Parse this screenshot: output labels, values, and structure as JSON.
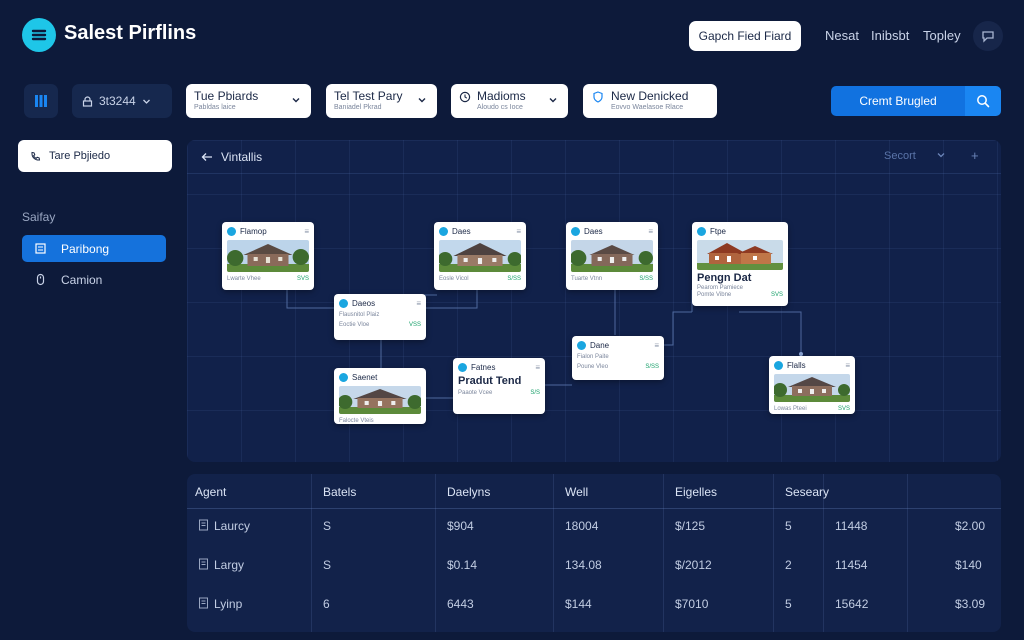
{
  "app": {
    "title": "Salest Pirflins"
  },
  "topbar": {
    "action_button": "Gapch Fied Fiard",
    "links": [
      "Nesat",
      "Inibsbt",
      "Topley"
    ]
  },
  "filterbar": {
    "id_select": "3t3244",
    "filters": [
      {
        "label": "Tue Pbiards",
        "sub": "Pabldas laice"
      },
      {
        "label": "Tel Test Pary",
        "sub": "Baniadel Pkrad"
      },
      {
        "label": "Madioms",
        "sub": "Aloudo cs Ioce"
      },
      {
        "label": "New Denicked",
        "sub": "Eovvo Waelasoe Rlace"
      }
    ],
    "primary_button": "Cremt Brugled"
  },
  "sidebar": {
    "input": "Tare Pbjiedo",
    "section": "Saifay",
    "items": [
      {
        "label": "Paribong",
        "active": true
      },
      {
        "label": "Camion",
        "active": false
      }
    ]
  },
  "canvas": {
    "title": "Vintallis",
    "search": "Secort",
    "cards": [
      {
        "name": "Flamop",
        "left": "Lwarte Vhee",
        "right": "SVS"
      },
      {
        "name": "Daes",
        "left": "Eosle Vicol",
        "right": "S/SS"
      },
      {
        "name": "Daes",
        "left": "Tuarte Vtnn",
        "right": "S/SS"
      },
      {
        "name": "Ftpe",
        "heading": "Pengn Dat",
        "sub": "Pearom Pamiece",
        "left": "Pomte Vibne",
        "right": "SVS"
      },
      {
        "name": "Daeos",
        "sub": "Flausnitol Plaiz",
        "left": "Eoctie Vloe",
        "right": "VSS"
      },
      {
        "name": "Saenet",
        "left": "Falocte Vteis"
      },
      {
        "name": "Fatnes",
        "heading": "Pradut Tend",
        "left": "Paaote Vcee",
        "right": "S/S"
      },
      {
        "name": "Dane",
        "sub": "Fialon Paite",
        "left": "Poune Vleo",
        "right": "S/SS"
      },
      {
        "name": "Flalls",
        "left": "Lowas Pteei",
        "right": "SVS"
      }
    ]
  },
  "table": {
    "headers": [
      "Agent",
      "Batels",
      "Daelyns",
      "Well",
      "Eigelles",
      "Seseary"
    ],
    "rows": [
      {
        "agent": "Laurcy",
        "c1": "S",
        "c2": "$904",
        "c3": "18004",
        "c4": "$/125",
        "c5": "5",
        "c6": "11448",
        "c7": "$2.00"
      },
      {
        "agent": "Largy",
        "c1": "S",
        "c2": "$0.14",
        "c3": "134.08",
        "c4": "$/2012",
        "c5": "2",
        "c6": "11454",
        "c7": "$140"
      },
      {
        "agent": "Lyinp",
        "c1": "6",
        "c2": "6443",
        "c3": "$144",
        "c4": "$7010",
        "c5": "5",
        "c6": "15642",
        "c7": "$3.09"
      }
    ]
  },
  "colors": {
    "background": "#0d1a3a",
    "accent": "#1572dc",
    "logo": "#1ec6e8"
  },
  "icons": [
    "logo-icon",
    "chat-icon",
    "grid-icon",
    "lock-icon",
    "chevron-down-icon",
    "search-icon",
    "phone-icon",
    "building-icon",
    "mouse-icon",
    "back-arrow-icon",
    "plus-icon",
    "menu-icon",
    "document-icon"
  ]
}
